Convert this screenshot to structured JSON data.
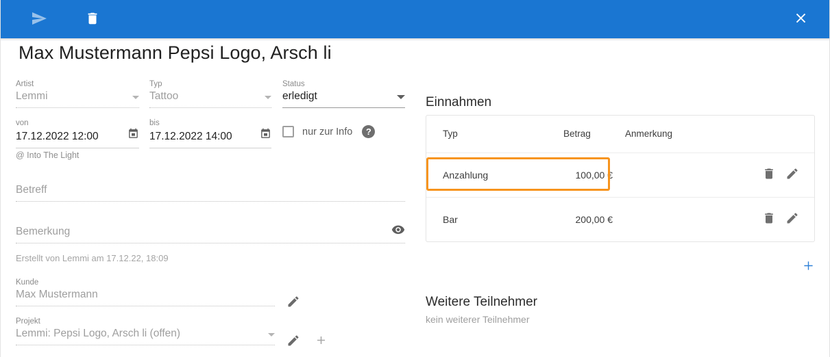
{
  "colors": {
    "toolbar_blue": "#1a76d2",
    "accent_orange": "#f7941d",
    "add_blue": "#2f80d8",
    "text_primary": "#212121",
    "text_muted": "#9e9e9e"
  },
  "toolbar": {
    "send_label": "send-icon",
    "delete_label": "delete-icon",
    "close_label": "close-icon"
  },
  "page_title": "Max Mustermann Pepsi Logo, Arsch li",
  "form": {
    "artist": {
      "label": "Artist",
      "value": "Lemmi",
      "disabled": true
    },
    "typ": {
      "label": "Typ",
      "value": "Tattoo",
      "disabled": true
    },
    "status": {
      "label": "Status",
      "value": "erledigt",
      "disabled": false
    },
    "von": {
      "label": "von",
      "value": "17.12.2022 12:00"
    },
    "bis": {
      "label": "bis",
      "value": "17.12.2022 14:00"
    },
    "venue": "@ Into The Light",
    "info_checkbox": {
      "label": "nur zur Info",
      "checked": false,
      "help": "?"
    },
    "betreff": {
      "label": "Betreff",
      "value": "",
      "placeholder": "Betreff"
    },
    "bemerkung": {
      "label": "Bemerkung",
      "value": "",
      "placeholder": "Bemerkung"
    },
    "created_note": "Erstellt von Lemmi am 17.12.22, 18:09",
    "kunde": {
      "label": "Kunde",
      "value": "Max Mustermann"
    },
    "projekt": {
      "label": "Projekt",
      "value": "Lemmi: Pepsi Logo, Arsch li (offen)"
    }
  },
  "einnahmen": {
    "title": "Einnahmen",
    "columns": [
      "Typ",
      "Betrag",
      "Anmerkung"
    ],
    "rows": [
      {
        "typ": "Anzahlung",
        "betrag": "100,00 €",
        "anmerkung": "",
        "highlighted": true
      },
      {
        "typ": "Bar",
        "betrag": "200,00 €",
        "anmerkung": "",
        "highlighted": false
      }
    ],
    "add_label": "+"
  },
  "teilnehmer": {
    "title": "Weitere Teilnehmer",
    "empty_text": "kein weiterer Teilnehmer"
  }
}
